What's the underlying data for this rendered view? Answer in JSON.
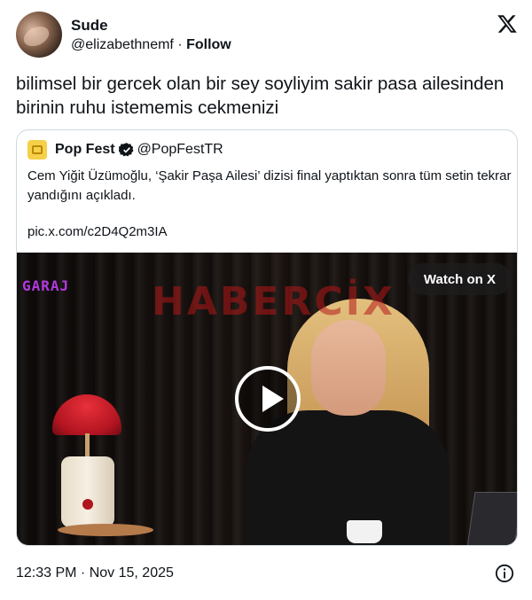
{
  "author": {
    "name": "Sude",
    "handle": "@elizabethnemf",
    "separator": "·",
    "follow_label": "Follow"
  },
  "platform_icon": "x-logo-icon",
  "tweet": {
    "text": "bilimsel bir gercek olan bir sey soyliyim sakir pasa ailesinden birinin ruhu istememis cekmenizi"
  },
  "quote": {
    "name": "Pop Fest",
    "verified_icon": "verified-badge-icon",
    "handle": "@PopFestTR",
    "text": "Cem Yiğit Üzümoğlu, ‘Şakir Paşa Ailesi’ dizisi final yaptıktan sonra tüm setin tekrar yandığını açıkladı.",
    "link": "pic.x.com/c2D4Q2m3IA"
  },
  "video": {
    "watch_label": "Watch on X",
    "channel_logo_text": "GARAJ",
    "watermark_text": "HABERCİX",
    "play_icon": "play-icon"
  },
  "footer": {
    "timestamp": "12:33 PM · Nov 15, 2025",
    "info_icon": "info-icon"
  },
  "colors": {
    "text": "#0f1419",
    "border": "#cfd9de",
    "verified": "#0f1419",
    "garaj": "#b23ae0",
    "watermark": "#b21818"
  }
}
